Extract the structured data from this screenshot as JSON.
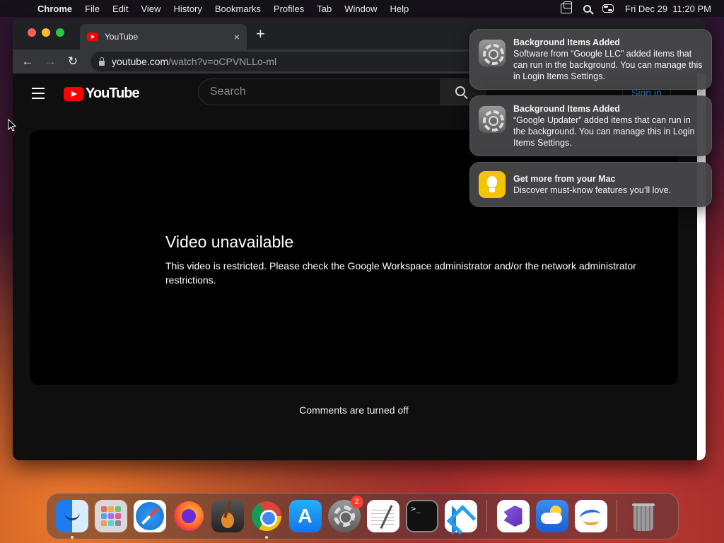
{
  "menubar": {
    "app_name": "Chrome",
    "items": [
      "File",
      "Edit",
      "View",
      "History",
      "Bookmarks",
      "Profiles",
      "Tab",
      "Window",
      "Help"
    ],
    "clock": "Fri Dec 29  11:20 PM",
    "status_icons": [
      "screen-mirroring-icon",
      "spotlight-search-icon",
      "control-center-icon"
    ]
  },
  "browser": {
    "tab": {
      "title": "YouTube",
      "close": "×"
    },
    "new_tab": "+",
    "url_domain": "youtube.com",
    "url_path": "/watch?v=oCPVNLLo-ml"
  },
  "youtube": {
    "logo_text": "YouTube",
    "search_placeholder": "Search",
    "sign_in": "Sign in",
    "error_title": "Video unavailable",
    "error_message": "This video is restricted. Please check the Google Workspace administrator and/or the network administrator restrictions.",
    "comments_status": "Comments are turned off"
  },
  "notifications": [
    {
      "title": "Background Items Added",
      "body": "Software from “Google LLC” added items that can run in the background. You can manage this in Login Items Settings.",
      "icon": "system-settings-icon"
    },
    {
      "title": "Background Items Added",
      "body": "“Google Updater” added items that can run in the background. You can manage this in Login Items Settings.",
      "icon": "system-settings-icon"
    },
    {
      "title": "Get more from your Mac",
      "body": "Discover must-know features you’ll love.",
      "icon": "tips-icon"
    }
  ],
  "dock": {
    "apps": [
      "Finder",
      "Launchpad",
      "Safari",
      "Firefox",
      "GarageBand",
      "Google Chrome",
      "App Store",
      "System Settings",
      "TextEdit",
      "Terminal",
      "Visual Studio Code",
      "Visual Studio",
      "Weather",
      "Freeform",
      "Trash"
    ],
    "system_settings_badge": "2"
  },
  "colors": {
    "youtube_red": "#ff0000",
    "chrome_tab": "#35363a",
    "sign_in_blue": "#3ea6ff"
  }
}
